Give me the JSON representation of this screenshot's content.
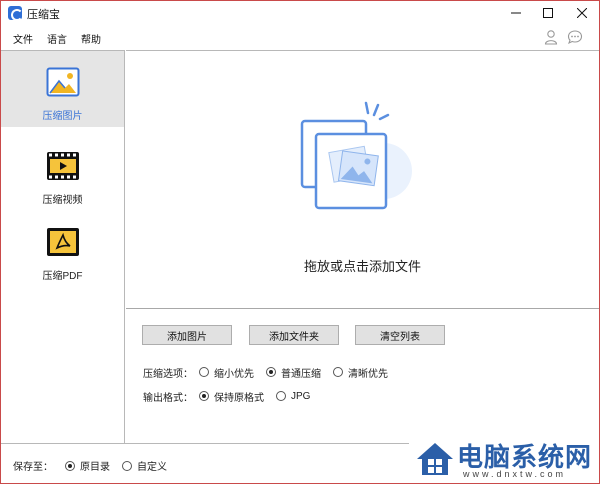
{
  "app": {
    "title": "压缩宝",
    "accent_color": "#3a74d6"
  },
  "menu": {
    "file": "文件",
    "language": "语言",
    "help": "帮助"
  },
  "sidebar": {
    "items": [
      {
        "label": "压缩图片",
        "icon": "image-icon",
        "active": true
      },
      {
        "label": "压缩视频",
        "icon": "video-icon",
        "active": false
      },
      {
        "label": "压缩PDF",
        "icon": "pdf-icon",
        "active": false
      }
    ]
  },
  "drop": {
    "hint": "拖放或点击添加文件"
  },
  "buttons": {
    "add_image": "添加图片",
    "add_folder": "添加文件夹",
    "clear_list": "清空列表"
  },
  "options": {
    "compress_label": "压缩选项：",
    "compress_choices": [
      {
        "label": "缩小优先",
        "selected": false
      },
      {
        "label": "普通压缩",
        "selected": true
      },
      {
        "label": "清晰优先",
        "selected": false
      }
    ],
    "format_label": "输出格式：",
    "format_choices": [
      {
        "label": "保持原格式",
        "selected": true
      },
      {
        "label": "JPG",
        "selected": false
      }
    ]
  },
  "save": {
    "label": "保存至：",
    "choices": [
      {
        "label": "原目录",
        "selected": true
      },
      {
        "label": "自定义",
        "selected": false
      }
    ]
  },
  "watermark": {
    "text": "电脑系统网",
    "url": "www.dnxtw.com"
  }
}
